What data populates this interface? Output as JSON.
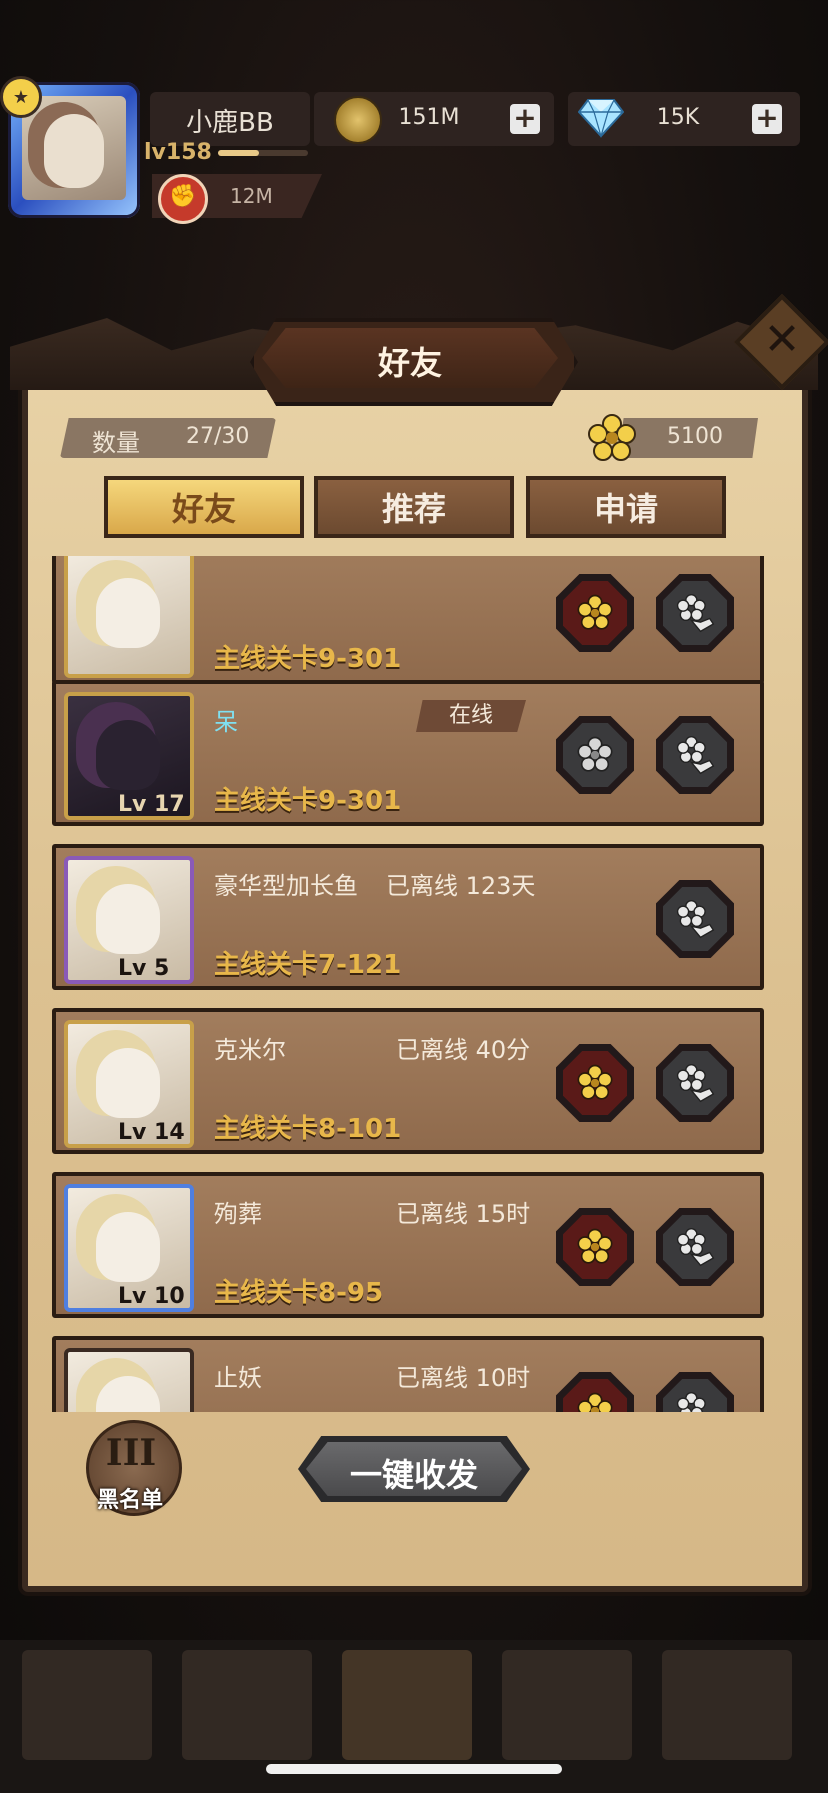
{
  "header": {
    "player_name": "小鹿BB",
    "level": "lv158",
    "xp_fraction": 0.45,
    "coins": "151M",
    "gems": "15K",
    "power": "12M"
  },
  "panel": {
    "title": "好友",
    "count_label": "数量",
    "count_value": "27/30",
    "flower_currency": "5100",
    "tabs": [
      {
        "label": "好友",
        "active": true
      },
      {
        "label": "推荐",
        "active": false
      },
      {
        "label": "申请",
        "active": false
      }
    ]
  },
  "friends": [
    {
      "name": "",
      "status": "",
      "stage": "主线关卡9-301",
      "frame": "gold",
      "level": "",
      "can_send": true,
      "can_claim": true
    },
    {
      "name": "呆",
      "status": "在线",
      "stage": "主线关卡9-301",
      "frame": "gold",
      "level": "Lv 17",
      "can_send": false,
      "can_claim": true
    },
    {
      "name": "豪华型加长鱼",
      "status": "已离线 123天",
      "stage": "主线关卡7-121",
      "frame": "purple",
      "level": "Lv 5",
      "can_send": false,
      "can_claim": true
    },
    {
      "name": "克米尔",
      "status": "已离线 40分",
      "stage": "主线关卡8-101",
      "frame": "gold",
      "level": "Lv 14",
      "can_send": true,
      "can_claim": true
    },
    {
      "name": "殉葬",
      "status": "已离线 15时",
      "stage": "主线关卡8-95",
      "frame": "blue",
      "level": "Lv 10",
      "can_send": true,
      "can_claim": true
    },
    {
      "name": "止妖",
      "status": "已离线 10时",
      "stage": "",
      "frame": "dark",
      "level": "",
      "can_send": true,
      "can_claim": true
    }
  ],
  "bottom": {
    "blacklist_label": "黑名单",
    "blacklist_numeral": "III",
    "oneclick_label": "一键收发"
  },
  "colors": {
    "panel_bg": "#dcc191",
    "card_bg": "#8f6a4c",
    "stage_text": "#e8b74a",
    "active_tab": "#f5d77c"
  }
}
